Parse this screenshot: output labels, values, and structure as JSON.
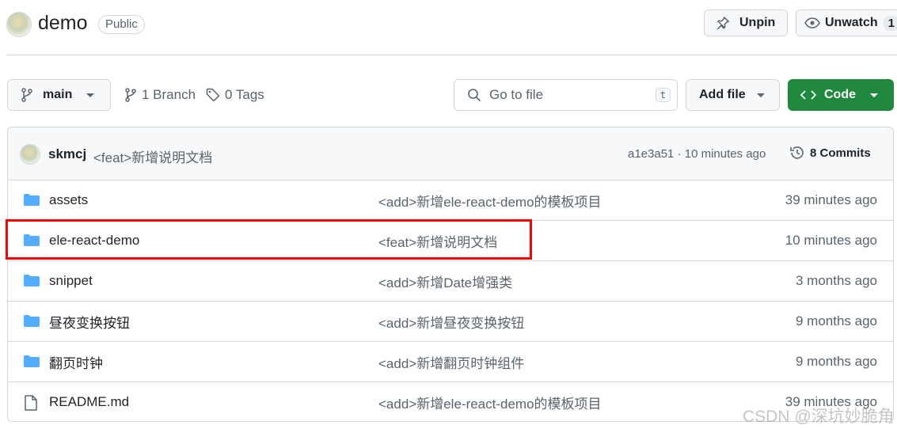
{
  "repo": {
    "name": "demo",
    "visibility": "Public"
  },
  "header_actions": {
    "unpin": "Unpin",
    "unwatch": "Unwatch",
    "watch_count": "1"
  },
  "toolbar": {
    "branch": "main",
    "branches": "1 Branch",
    "tags": "0 Tags",
    "search_placeholder": "Go to file",
    "search_shortcut": "t",
    "add_file": "Add file",
    "code": "Code"
  },
  "latest_commit": {
    "author": "skmcj",
    "message": "<feat>新增说明文档",
    "hash_time": "a1e3a51 · 10 minutes ago",
    "commits": "8 Commits"
  },
  "files": [
    {
      "name": "assets",
      "type": "folder",
      "message": "<add>新增ele-react-demo的模板项目",
      "time": "39 minutes ago"
    },
    {
      "name": "ele-react-demo",
      "type": "folder",
      "message": "<feat>新增说明文档",
      "time": "10 minutes ago",
      "highlighted": true
    },
    {
      "name": "snippet",
      "type": "folder",
      "message": "<add>新增Date增强类",
      "time": "3 months ago"
    },
    {
      "name": "昼夜变换按钮",
      "type": "folder",
      "message": "<add>新增昼夜变换按钮",
      "time": "9 months ago"
    },
    {
      "name": "翻页时钟",
      "type": "folder",
      "message": "<add>新增翻页时钟组件",
      "time": "9 months ago"
    },
    {
      "name": "README.md",
      "type": "file",
      "message": "<add>新增ele-react-demo的模板项目",
      "time": "39 minutes ago"
    }
  ],
  "colors": {
    "folder": "#54aeff",
    "code_button": "#1f883d",
    "highlight": "#ff0000"
  },
  "watermark": "CSDN @深坑妙脆角"
}
